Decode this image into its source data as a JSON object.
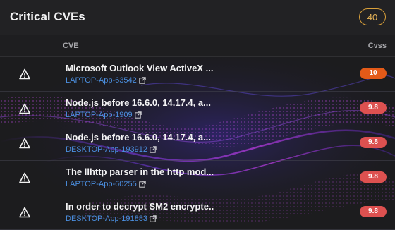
{
  "header": {
    "title": "Critical CVEs",
    "count": "40"
  },
  "columns": {
    "cve": "CVE",
    "cvss": "Cvss"
  },
  "colors": {
    "score_high": "#e35a18",
    "score_critical": "#dd5150",
    "link": "#4b8fe0",
    "count_border": "#d9a03a"
  },
  "rows": [
    {
      "title": "Microsoft Outlook View ActiveX ...",
      "asset": "LAPTOP-App-63542",
      "score": "10",
      "level": "high"
    },
    {
      "title": "Node.js before 16.6.0, 14.17.4, a...",
      "asset": "LAPTOP-App-1909",
      "score": "9.8",
      "level": "critical"
    },
    {
      "title": "Node.js before 16.6.0, 14.17.4, a...",
      "asset": "DESKTOP-App-193912",
      "score": "9.8",
      "level": "critical"
    },
    {
      "title": "The llhttp parser in the http mod...",
      "asset": "LAPTOP-App-60255",
      "score": "9.8",
      "level": "critical"
    },
    {
      "title": "In order to decrypt SM2 encrypte...",
      "asset": "DESKTOP-App-191883",
      "score": "9.8",
      "level": "critical"
    }
  ]
}
